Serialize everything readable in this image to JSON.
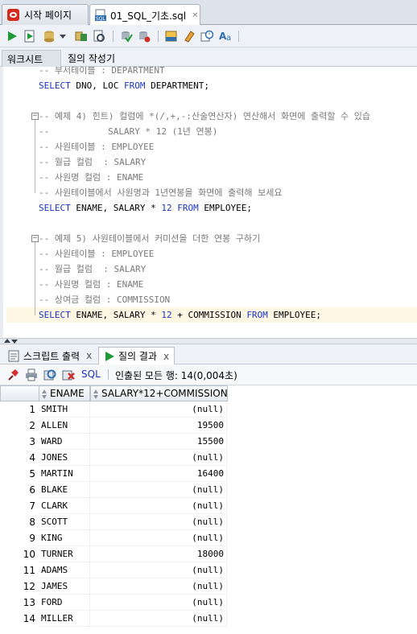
{
  "doc_tabs": [
    {
      "label": "시작 페이지",
      "icon": "oracle-icon",
      "active": false
    },
    {
      "label": "01_SQL_기초.sql",
      "icon": "sql-file-icon",
      "active": true
    }
  ],
  "toolbar": {
    "icons": [
      "run-statement-icon",
      "run-script-icon",
      "commit-icon",
      "chevron-down-icon",
      "explain-plan-icon",
      "autotrace-icon",
      "commit-db-icon",
      "rollback-icon",
      "sql-tuning-icon",
      "eraser-icon",
      "history-icon",
      "format-text-icon"
    ]
  },
  "sub_tabs": [
    "워크시트",
    "질의 작성기"
  ],
  "editor": {
    "lines": [
      [
        {
          "t": "cmt",
          "v": "-- 부서테이블 : DEPARTMENT"
        }
      ],
      [
        {
          "t": "kw",
          "v": "SELECT"
        },
        {
          "t": "",
          "v": " DNO, LOC "
        },
        {
          "t": "kw",
          "v": "FROM"
        },
        {
          "t": "",
          "v": " DEPARTMENT;"
        }
      ],
      [],
      [
        {
          "t": "cmt",
          "v": "-- 예제 4) 힌트) 컬럼에 *(/,+,-:산술연산자) 연산해서 화면에 출력할 수 있습"
        }
      ],
      [
        {
          "t": "cmt",
          "v": "--           SALARY * 12 (1년 연봉)"
        }
      ],
      [
        {
          "t": "cmt",
          "v": "-- 사원테이블 : EMPLOYEE"
        }
      ],
      [
        {
          "t": "cmt",
          "v": "-- 월급 컬럼  : SALARY"
        }
      ],
      [
        {
          "t": "cmt",
          "v": "-- 사원명 컬럼 : ENAME"
        }
      ],
      [
        {
          "t": "cmt",
          "v": "-- 사원테이블에서 사원명과 1년연봉을 화면에 출력해 보세요"
        }
      ],
      [
        {
          "t": "kw",
          "v": "SELECT"
        },
        {
          "t": "",
          "v": " ENAME, SALARY * "
        },
        {
          "t": "num",
          "v": "12"
        },
        {
          "t": "",
          "v": " "
        },
        {
          "t": "kw",
          "v": "FROM"
        },
        {
          "t": "",
          "v": " EMPLOYEE;"
        }
      ],
      [],
      [
        {
          "t": "cmt",
          "v": "-- 예제 5) 사원테이블에서 커미션을 더한 연봉 구하기"
        }
      ],
      [
        {
          "t": "cmt",
          "v": "-- 사원테이블 : EMPLOYEE"
        }
      ],
      [
        {
          "t": "cmt",
          "v": "-- 월급 컬럼  : SALARY"
        }
      ],
      [
        {
          "t": "cmt",
          "v": "-- 사원명 컬럼 : ENAME"
        }
      ],
      [
        {
          "t": "cmt",
          "v": "-- 상여금 컬럼 : COMMISSION"
        }
      ],
      [
        {
          "t": "kw",
          "v": "SELECT"
        },
        {
          "t": "",
          "v": " ENAME, SALARY * "
        },
        {
          "t": "num",
          "v": "12"
        },
        {
          "t": "",
          "v": " + COMMISSION "
        },
        {
          "t": "kw",
          "v": "FROM"
        },
        {
          "t": "",
          "v": " EMPLOYEE;"
        }
      ]
    ]
  },
  "result_tabs": [
    {
      "label": "스크립트 출력",
      "close": "x",
      "active": false
    },
    {
      "label": "질의 결과",
      "close": "x",
      "active": true
    }
  ],
  "result_toolbar": {
    "sql_label": "SQL",
    "status": "인출된 모든 행: 14(0,004초)"
  },
  "grid": {
    "columns": [
      "ENAME",
      "SALARY*12+COMMISSION"
    ],
    "rows": [
      {
        "n": "1",
        "ename": "SMITH",
        "val": "(null)"
      },
      {
        "n": "2",
        "ename": "ALLEN",
        "val": "19500"
      },
      {
        "n": "3",
        "ename": "WARD",
        "val": "15500"
      },
      {
        "n": "4",
        "ename": "JONES",
        "val": "(null)"
      },
      {
        "n": "5",
        "ename": "MARTIN",
        "val": "16400"
      },
      {
        "n": "6",
        "ename": "BLAKE",
        "val": "(null)"
      },
      {
        "n": "7",
        "ename": "CLARK",
        "val": "(null)"
      },
      {
        "n": "8",
        "ename": "SCOTT",
        "val": "(null)"
      },
      {
        "n": "9",
        "ename": "KING",
        "val": "(null)"
      },
      {
        "n": "10",
        "ename": "TURNER",
        "val": "18000"
      },
      {
        "n": "11",
        "ename": "ADAMS",
        "val": "(null)"
      },
      {
        "n": "12",
        "ename": "JAMES",
        "val": "(null)"
      },
      {
        "n": "13",
        "ename": "FORD",
        "val": "(null)"
      },
      {
        "n": "14",
        "ename": "MILLER",
        "val": "(null)"
      }
    ]
  }
}
